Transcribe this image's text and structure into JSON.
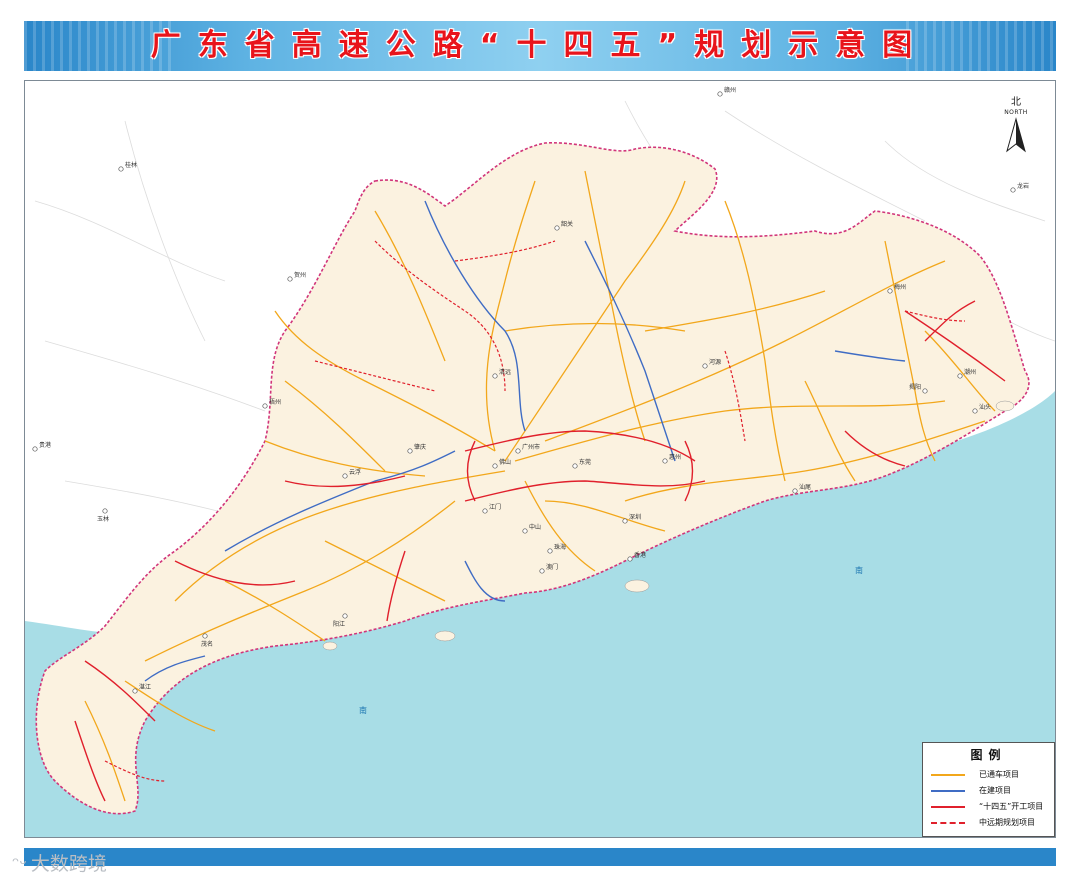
{
  "title": "广东省高速公路“十四五”规划示意图",
  "compass": {
    "cn": "北",
    "en": "NORTH"
  },
  "legend": {
    "title": "图例",
    "items": [
      {
        "label": "已通车项目",
        "color": "#f2a71b",
        "style": "solid"
      },
      {
        "label": "在建项目",
        "color": "#3f6cc4",
        "style": "solid"
      },
      {
        "label": "“十四五”开工项目",
        "color": "#e0202c",
        "style": "solid"
      },
      {
        "label": "中远期规划项目",
        "color": "#e0202c",
        "style": "dashed"
      }
    ]
  },
  "sea_labels": [
    "南",
    "南"
  ],
  "cities": [
    {
      "id": "shaoguan",
      "label": "韶关"
    },
    {
      "id": "qingyuan",
      "label": "清远"
    },
    {
      "id": "guangzhou",
      "label": "广州市"
    },
    {
      "id": "foshan",
      "label": "佛山"
    },
    {
      "id": "zhaoqing",
      "label": "肇庆"
    },
    {
      "id": "yunfu",
      "label": "云浮"
    },
    {
      "id": "dongguan",
      "label": "东莞"
    },
    {
      "id": "huizhou",
      "label": "惠州"
    },
    {
      "id": "shenzhen",
      "label": "深圳"
    },
    {
      "id": "jiangmen",
      "label": "江门"
    },
    {
      "id": "zhongshan",
      "label": "中山"
    },
    {
      "id": "zhuhai",
      "label": "珠海"
    },
    {
      "id": "aomen",
      "label": "澳门"
    },
    {
      "id": "xianggang",
      "label": "香港"
    },
    {
      "id": "heyuan",
      "label": "河源"
    },
    {
      "id": "meizhou",
      "label": "梅州"
    },
    {
      "id": "chaozhou",
      "label": "潮州"
    },
    {
      "id": "shantou",
      "label": "汕头"
    },
    {
      "id": "jieyang",
      "label": "揭阳"
    },
    {
      "id": "shanwei",
      "label": "汕尾"
    },
    {
      "id": "yangjiang",
      "label": "阳江"
    },
    {
      "id": "maoming",
      "label": "茂名"
    },
    {
      "id": "zhanjiang",
      "label": "湛江"
    },
    {
      "id": "ganzhou",
      "label": "赣州"
    },
    {
      "id": "longyan",
      "label": "龙岩"
    },
    {
      "id": "hezhou",
      "label": "贺州"
    },
    {
      "id": "wuzhou",
      "label": "梧州"
    },
    {
      "id": "yulin",
      "label": "玉林"
    },
    {
      "id": "guigang",
      "label": "贵港"
    },
    {
      "id": "guilin",
      "label": "桂林"
    }
  ],
  "watermark": "大数跨境",
  "colors": {
    "sea": "#a8dde6",
    "land": "#fbf2e0",
    "neighbor": "#ffffff",
    "border": "#d1357a",
    "open_road": "#f2a71b",
    "building_road": "#3f6cc4",
    "new_road": "#e0202c",
    "banner_title": "#e8141b",
    "banner_bg": "#2a86c9"
  }
}
